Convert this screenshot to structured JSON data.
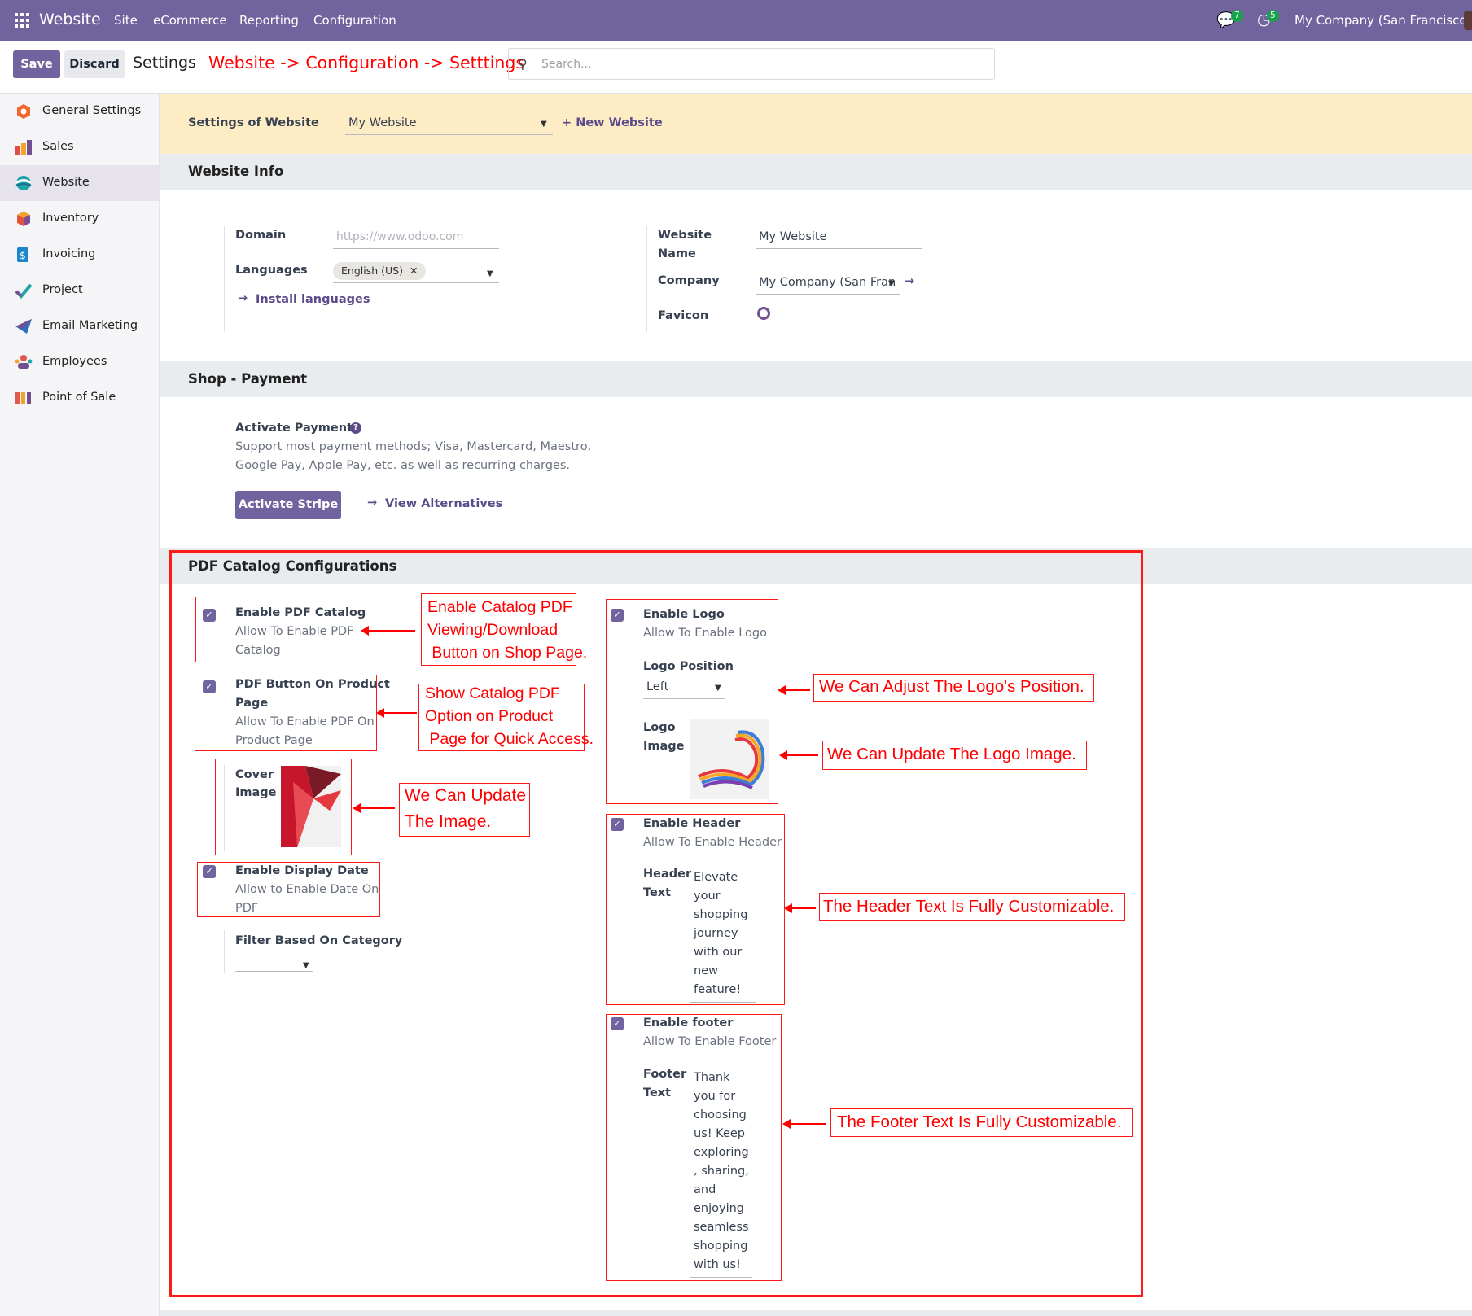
{
  "navbar": {
    "app_title": "Website",
    "menu": [
      "Site",
      "eCommerce",
      "Reporting",
      "Configuration"
    ],
    "messages_badge": "7",
    "activity_badge": "5",
    "company": "My Company (San Francisco)"
  },
  "control_panel": {
    "save_label": "Save",
    "discard_label": "Discard",
    "breadcrumb": "Settings",
    "annotation": "Website -> Configuration -> Setttings",
    "search_placeholder": "Search..."
  },
  "sidebar": {
    "items": [
      {
        "label": "General Settings",
        "icon": "general-settings-icon"
      },
      {
        "label": "Sales",
        "icon": "sales-icon"
      },
      {
        "label": "Website",
        "icon": "website-icon",
        "active": true
      },
      {
        "label": "Inventory",
        "icon": "inventory-icon"
      },
      {
        "label": "Invoicing",
        "icon": "invoicing-icon"
      },
      {
        "label": "Project",
        "icon": "project-icon"
      },
      {
        "label": "Email Marketing",
        "icon": "email-marketing-icon"
      },
      {
        "label": "Employees",
        "icon": "employees-icon"
      },
      {
        "label": "Point of Sale",
        "icon": "point-of-sale-icon"
      }
    ]
  },
  "banner": {
    "label": "Settings of Website",
    "website_value": "My Website",
    "new_website": "+ New Website"
  },
  "website_info": {
    "title": "Website Info",
    "domain_label": "Domain",
    "domain_placeholder": "https://www.odoo.com",
    "languages_label": "Languages",
    "language_tag": "English (US)",
    "install_languages": "Install languages",
    "website_name_label_1": "Website",
    "website_name_label_2": "Name",
    "website_name_value": "My Website",
    "company_label": "Company",
    "company_value": "My Company (San Fran",
    "favicon_label": "Favicon"
  },
  "shop_payment": {
    "title": "Shop - Payment",
    "activate_label": "Activate Payments",
    "desc_1": "Support most payment methods; Visa, Mastercard, Maestro,",
    "desc_2": "Google Pay, Apple Pay, etc. as well as recurring charges.",
    "stripe_button": "Activate Stripe",
    "view_alternatives": "View Alternatives"
  },
  "pdf_catalog": {
    "title": "PDF Catalog Configurations",
    "enable_pdf_label": "Enable PDF Catalog",
    "enable_pdf_desc_1": "Allow To Enable PDF",
    "enable_pdf_desc_2": "Catalog",
    "pdf_button_label_1": "PDF Button On Product",
    "pdf_button_label_2": "Page",
    "pdf_button_desc_1": "Allow To Enable PDF On",
    "pdf_button_desc_2": "Product Page",
    "cover_label_1": "Cover",
    "cover_label_2": "Image",
    "display_date_label": "Enable Display Date",
    "display_date_desc_1": "Allow to Enable Date On",
    "display_date_desc_2": "PDF",
    "filter_label": "Filter Based On Category",
    "enable_logo_label": "Enable Logo",
    "enable_logo_desc": "Allow To Enable Logo",
    "logo_position_label": "Logo Position",
    "logo_position_value": "Left",
    "logo_image_label_1": "Logo",
    "logo_image_label_2": "Image",
    "enable_header_label": "Enable Header",
    "enable_header_desc": "Allow To Enable Header",
    "header_text_label_1": "Header",
    "header_text_label_2": "Text",
    "header_text_lines": [
      "Elevate",
      "your",
      "shopping",
      "journey",
      "with our",
      "new",
      "feature!"
    ],
    "enable_footer_label": "Enable footer",
    "enable_footer_desc": "Allow To Enable Footer",
    "footer_text_label_1": "Footer",
    "footer_text_label_2": "Text",
    "footer_text_lines": [
      "Thank",
      "you for",
      "choosing",
      "us! Keep",
      "exploring",
      ", sharing,",
      "and",
      "enjoying",
      "seamless",
      "shopping",
      "with us!"
    ]
  },
  "annotations": {
    "a1": [
      "Enable Catalog PDF",
      "Viewing/Download",
      " Button on Shop Page."
    ],
    "a2": [
      "Show Catalog PDF",
      "Option on Product",
      " Page for Quick Access."
    ],
    "a3": [
      "We Can Update",
      "The Image."
    ],
    "a4": "We Can Adjust The Logo's Position.",
    "a5": "We Can Update The Logo Image.",
    "a6": "The Header Text Is Fully Customizable.",
    "a7": "The Footer Text Is Fully Customizable."
  },
  "colors": {
    "brand": "#71639e",
    "annotation": "#ff0000",
    "banner": "#fdecc4",
    "badge": "#17a34a"
  }
}
